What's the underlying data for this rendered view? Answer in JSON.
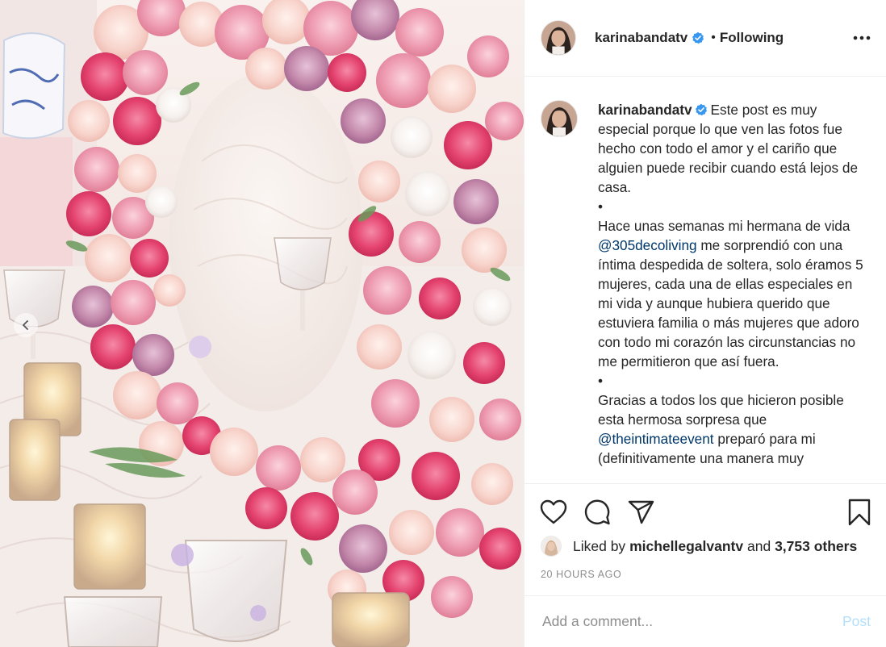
{
  "post": {
    "image_alt": "Floral arch of pink and white roses on a decorated table",
    "carousel_prev_icon": "chevron-left-icon"
  },
  "header": {
    "username": "karinabandatv",
    "verified_icon": "verified-badge-icon",
    "separator": "•",
    "following_label": "Following",
    "more_icon": "more-options-icon"
  },
  "caption": {
    "username": "karinabandatv",
    "text_1": "Este post es muy especial porque lo que ven las fotos fue hecho con todo el amor y el cariño que alguien puede recibir cuando está lejos de casa.",
    "bullet_1": "•",
    "text_2_before": "Hace unas semanas mi hermana de vida ",
    "mention_1": "@305decoliving",
    "text_2_after": " me sorprendió con una íntima despedida de soltera, solo éramos 5 mujeres, cada una de ellas especiales en mi vida y aunque hubiera querido que estuviera familia o más mujeres que adoro con todo mi corazón las circunstancias no me permitieron que así fuera.",
    "bullet_2": "•",
    "text_3_before": "Gracias a todos los que hicieron posible esta hermosa sorpresa que ",
    "mention_2": "@theintimateevent",
    "text_3_after": " preparó para mi (definitivamente una manera muy"
  },
  "actions": {
    "like_icon": "heart-icon",
    "comment_icon": "comment-icon",
    "share_icon": "share-icon",
    "save_icon": "bookmark-icon"
  },
  "likes": {
    "prefix": "Liked by ",
    "user": "michellegalvantv",
    "middle": " and ",
    "others": "3,753 others"
  },
  "timestamp": "20 HOURS AGO",
  "comment": {
    "placeholder": "Add a comment...",
    "post_label": "Post"
  },
  "colors": {
    "text": "#262626",
    "secondary": "#8e8e8e",
    "mention": "#00376b",
    "verified": "#3897f0",
    "post_disabled": "#b2dffc",
    "border": "#efefef"
  }
}
